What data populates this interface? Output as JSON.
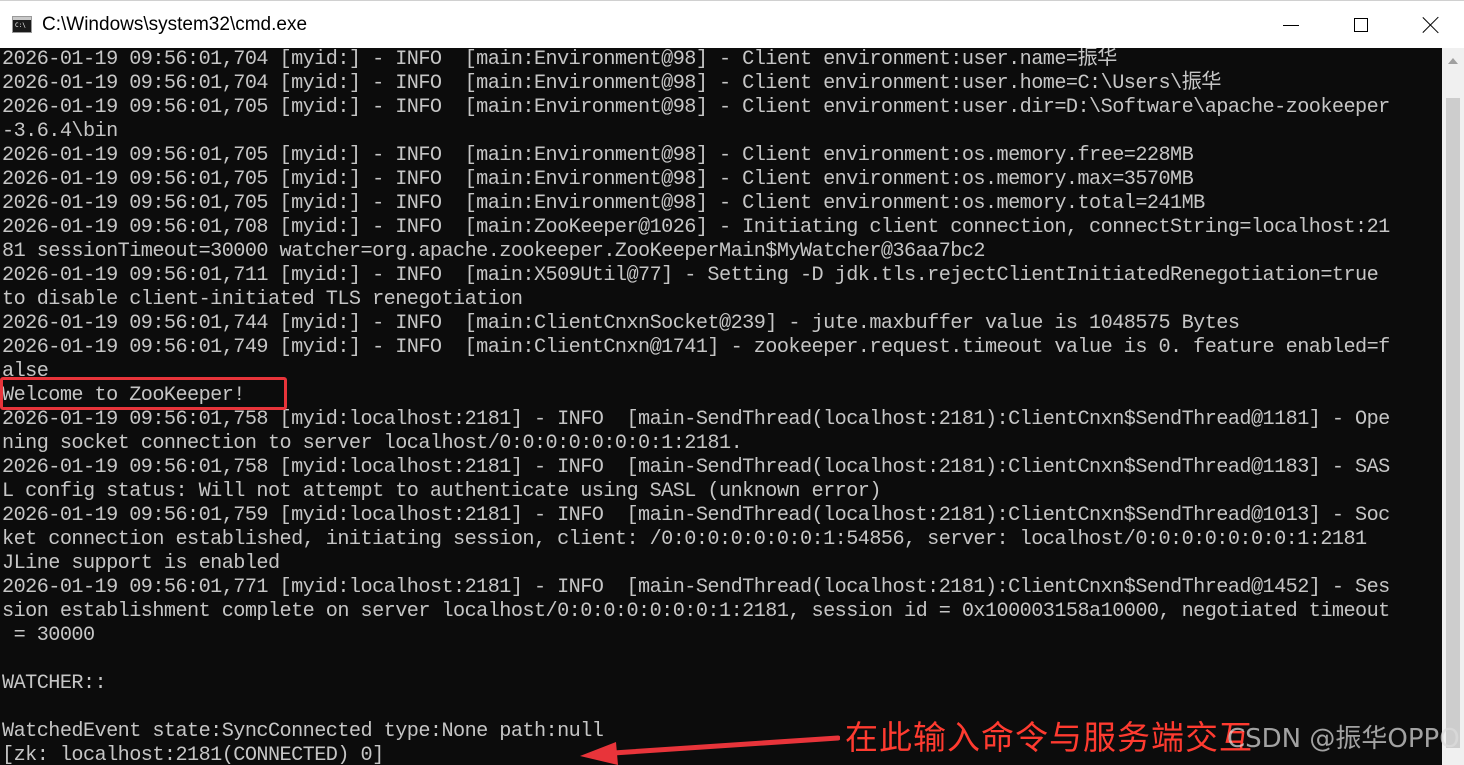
{
  "window": {
    "title": "C:\\Windows\\system32\\cmd.exe",
    "icon": "cmd-app-icon",
    "buttons": {
      "minimize": "minimize-icon",
      "maximize": "maximize-icon",
      "close": "close-icon"
    }
  },
  "console": {
    "lines": [
      "2026-01-19 09:56:01,704 [myid:] - INFO  [main:Environment@98] - Client environment:user.name=振华",
      "2026-01-19 09:56:01,704 [myid:] - INFO  [main:Environment@98] - Client environment:user.home=C:\\Users\\振华",
      "2026-01-19 09:56:01,705 [myid:] - INFO  [main:Environment@98] - Client environment:user.dir=D:\\Software\\apache-zookeeper",
      "-3.6.4\\bin",
      "2026-01-19 09:56:01,705 [myid:] - INFO  [main:Environment@98] - Client environment:os.memory.free=228MB",
      "2026-01-19 09:56:01,705 [myid:] - INFO  [main:Environment@98] - Client environment:os.memory.max=3570MB",
      "2026-01-19 09:56:01,705 [myid:] - INFO  [main:Environment@98] - Client environment:os.memory.total=241MB",
      "2026-01-19 09:56:01,708 [myid:] - INFO  [main:ZooKeeper@1026] - Initiating client connection, connectString=localhost:21",
      "81 sessionTimeout=30000 watcher=org.apache.zookeeper.ZooKeeperMain$MyWatcher@36aa7bc2",
      "2026-01-19 09:56:01,711 [myid:] - INFO  [main:X509Util@77] - Setting -D jdk.tls.rejectClientInitiatedRenegotiation=true",
      "to disable client-initiated TLS renegotiation",
      "2026-01-19 09:56:01,744 [myid:] - INFO  [main:ClientCnxnSocket@239] - jute.maxbuffer value is 1048575 Bytes",
      "2026-01-19 09:56:01,749 [myid:] - INFO  [main:ClientCnxn@1741] - zookeeper.request.timeout value is 0. feature enabled=f",
      "alse",
      "Welcome to ZooKeeper!",
      "2026-01-19 09:56:01,758 [myid:localhost:2181] - INFO  [main-SendThread(localhost:2181):ClientCnxn$SendThread@1181] - Ope",
      "ning socket connection to server localhost/0:0:0:0:0:0:0:1:2181.",
      "2026-01-19 09:56:01,758 [myid:localhost:2181] - INFO  [main-SendThread(localhost:2181):ClientCnxn$SendThread@1183] - SAS",
      "L config status: Will not attempt to authenticate using SASL (unknown error)",
      "2026-01-19 09:56:01,759 [myid:localhost:2181] - INFO  [main-SendThread(localhost:2181):ClientCnxn$SendThread@1013] - Soc",
      "ket connection established, initiating session, client: /0:0:0:0:0:0:0:1:54856, server: localhost/0:0:0:0:0:0:0:1:2181",
      "JLine support is enabled",
      "2026-01-19 09:56:01,771 [myid:localhost:2181] - INFO  [main-SendThread(localhost:2181):ClientCnxn$SendThread@1452] - Ses",
      "sion establishment complete on server localhost/0:0:0:0:0:0:0:1:2181, session id = 0x100003158a10000, negotiated timeout",
      " = 30000",
      "",
      "WATCHER::",
      "",
      "WatchedEvent state:SyncConnected type:None path:null",
      "[zk: localhost:2181(CONNECTED) 0]"
    ],
    "background": "#0c0c0c",
    "text_color": "#c6c6c6"
  },
  "annotation": {
    "text": "在此输入命令与服务端交互",
    "color": "#ff3b30",
    "highlight_color": "#e8343a"
  },
  "watermark": {
    "text": "CSDN @振华OPPO"
  }
}
